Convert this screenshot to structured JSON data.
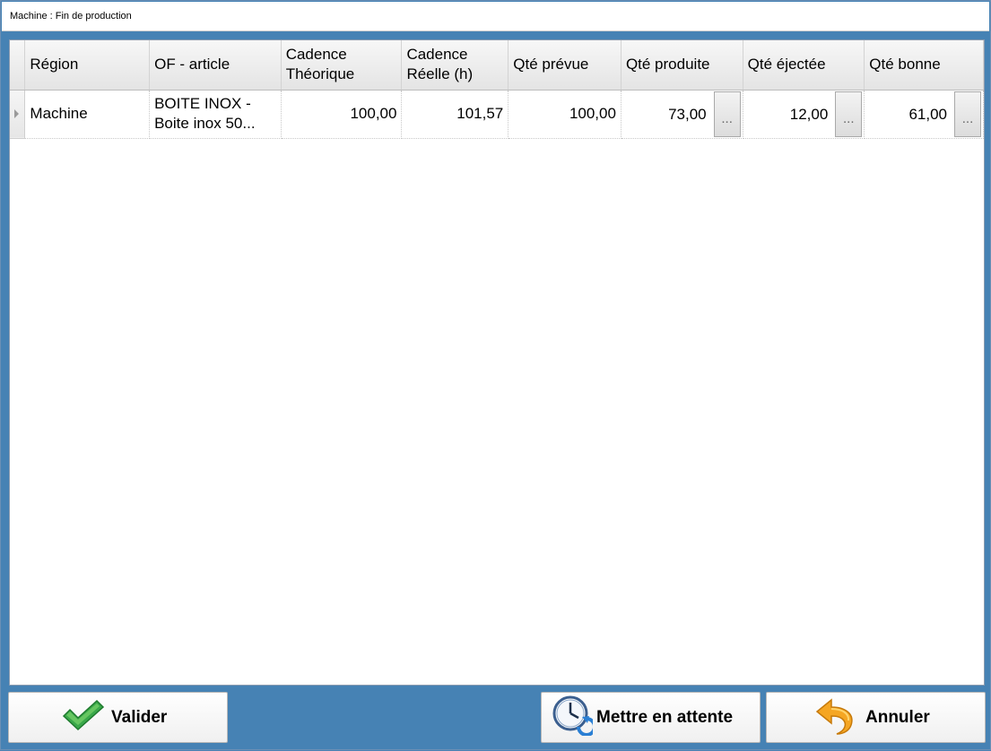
{
  "window": {
    "title": "Machine : Fin de production"
  },
  "grid": {
    "columns": [
      {
        "line1": "Région",
        "line2": ""
      },
      {
        "line1": "OF - article",
        "line2": ""
      },
      {
        "line1": "Cadence",
        "line2": "Théorique"
      },
      {
        "line1": "Cadence",
        "line2": "Réelle (h)"
      },
      {
        "line1": "Qté prévue",
        "line2": ""
      },
      {
        "line1": "Qté produite",
        "line2": ""
      },
      {
        "line1": "Qté éjectée",
        "line2": ""
      },
      {
        "line1": "Qté bonne",
        "line2": ""
      }
    ],
    "rows": [
      {
        "region": "Machine",
        "of_article_line1": "BOITE INOX -",
        "of_article_line2": "Boite  inox  50...",
        "cadence_theorique": "100,00",
        "cadence_reelle": "101,57",
        "qte_prevue": "100,00",
        "qte_produite": "73,00",
        "qte_ejectee": "12,00",
        "qte_bonne": "61,00",
        "ellipsis": "..."
      }
    ]
  },
  "buttons": {
    "validate": "Valider",
    "hold": "Mettre en attente",
    "cancel": "Annuler"
  },
  "icons": {
    "validate": "green-checkmark-icon",
    "hold": "clock-refresh-icon",
    "cancel": "orange-undo-arrow-icon"
  },
  "colors": {
    "background": "#4682b4",
    "check_green": "#3aa84a",
    "undo_orange": "#f5a623"
  }
}
